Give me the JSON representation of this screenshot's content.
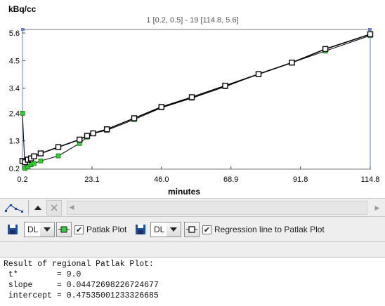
{
  "plot": {
    "y_unit_label": "kBq/cc",
    "x_label": "minutes",
    "range_label": "1 [0.2, 0.5] - 19 [114.8, 5.6]",
    "colors": {
      "series_a": "#33cc33",
      "series_b": "#ffffff",
      "line": "#000000"
    }
  },
  "chart_data": {
    "type": "line",
    "xlabel": "minutes",
    "ylabel": "kBq/cc",
    "xlim": [
      0.2,
      114.8
    ],
    "ylim": [
      0.2,
      5.6
    ],
    "x_ticks": [
      "0.2",
      "23.1",
      "46.0",
      "68.9",
      "91.8",
      "114.8"
    ],
    "y_ticks": [
      "0.2",
      "1.3",
      "2.4",
      "3.4",
      "4.5",
      "5.6"
    ],
    "grid": false,
    "series": [
      {
        "x": [
          0.2,
          1.0,
          2.0,
          3.0,
          4.0,
          6.2,
          12.0,
          19.0,
          21.5,
          23.5,
          28.0,
          37.0,
          46.0,
          56.0,
          67.0,
          78.0,
          89.0,
          100.0,
          114.8
        ],
        "y": [
          2.4,
          0.2,
          0.27,
          0.35,
          0.4,
          0.5,
          0.7,
          1.2,
          1.45,
          1.6,
          1.72,
          2.15,
          2.62,
          3.0,
          3.46,
          3.96,
          4.42,
          4.88,
          5.5
        ]
      },
      {
        "x": [
          0.2,
          1.0,
          2.0,
          3.0,
          4.0,
          6.2,
          12.0,
          19.0,
          21.5,
          23.5,
          28.0,
          37.0,
          46.0,
          56.0,
          67.0,
          78.0,
          89.0,
          100.0,
          114.8
        ],
        "y": [
          0.5,
          0.45,
          0.55,
          0.6,
          0.68,
          0.8,
          1.05,
          1.35,
          1.5,
          1.6,
          1.76,
          2.2,
          2.65,
          3.04,
          3.5,
          3.96,
          4.42,
          4.96,
          5.55
        ]
      }
    ]
  },
  "nav": {
    "icons": [
      "line-shape-icon",
      "triangle-up-icon",
      "close-icon",
      "scroll-left-icon",
      "scroll-right-icon"
    ]
  },
  "controls": {
    "left": {
      "combo_value": "DL",
      "checkbox_checked": true,
      "checkbox_label": "Patlak Plot"
    },
    "right": {
      "combo_value": "DL",
      "checkbox_checked": true,
      "checkbox_label": "Regression line to Patlak Plot"
    }
  },
  "result": {
    "title": "Result of regional Patlak Plot:",
    "t_star": " t*        = 9.0",
    "slope": " slope     = 0.04472698226724677",
    "intercept": " intercept = 0.47535001233326685"
  }
}
